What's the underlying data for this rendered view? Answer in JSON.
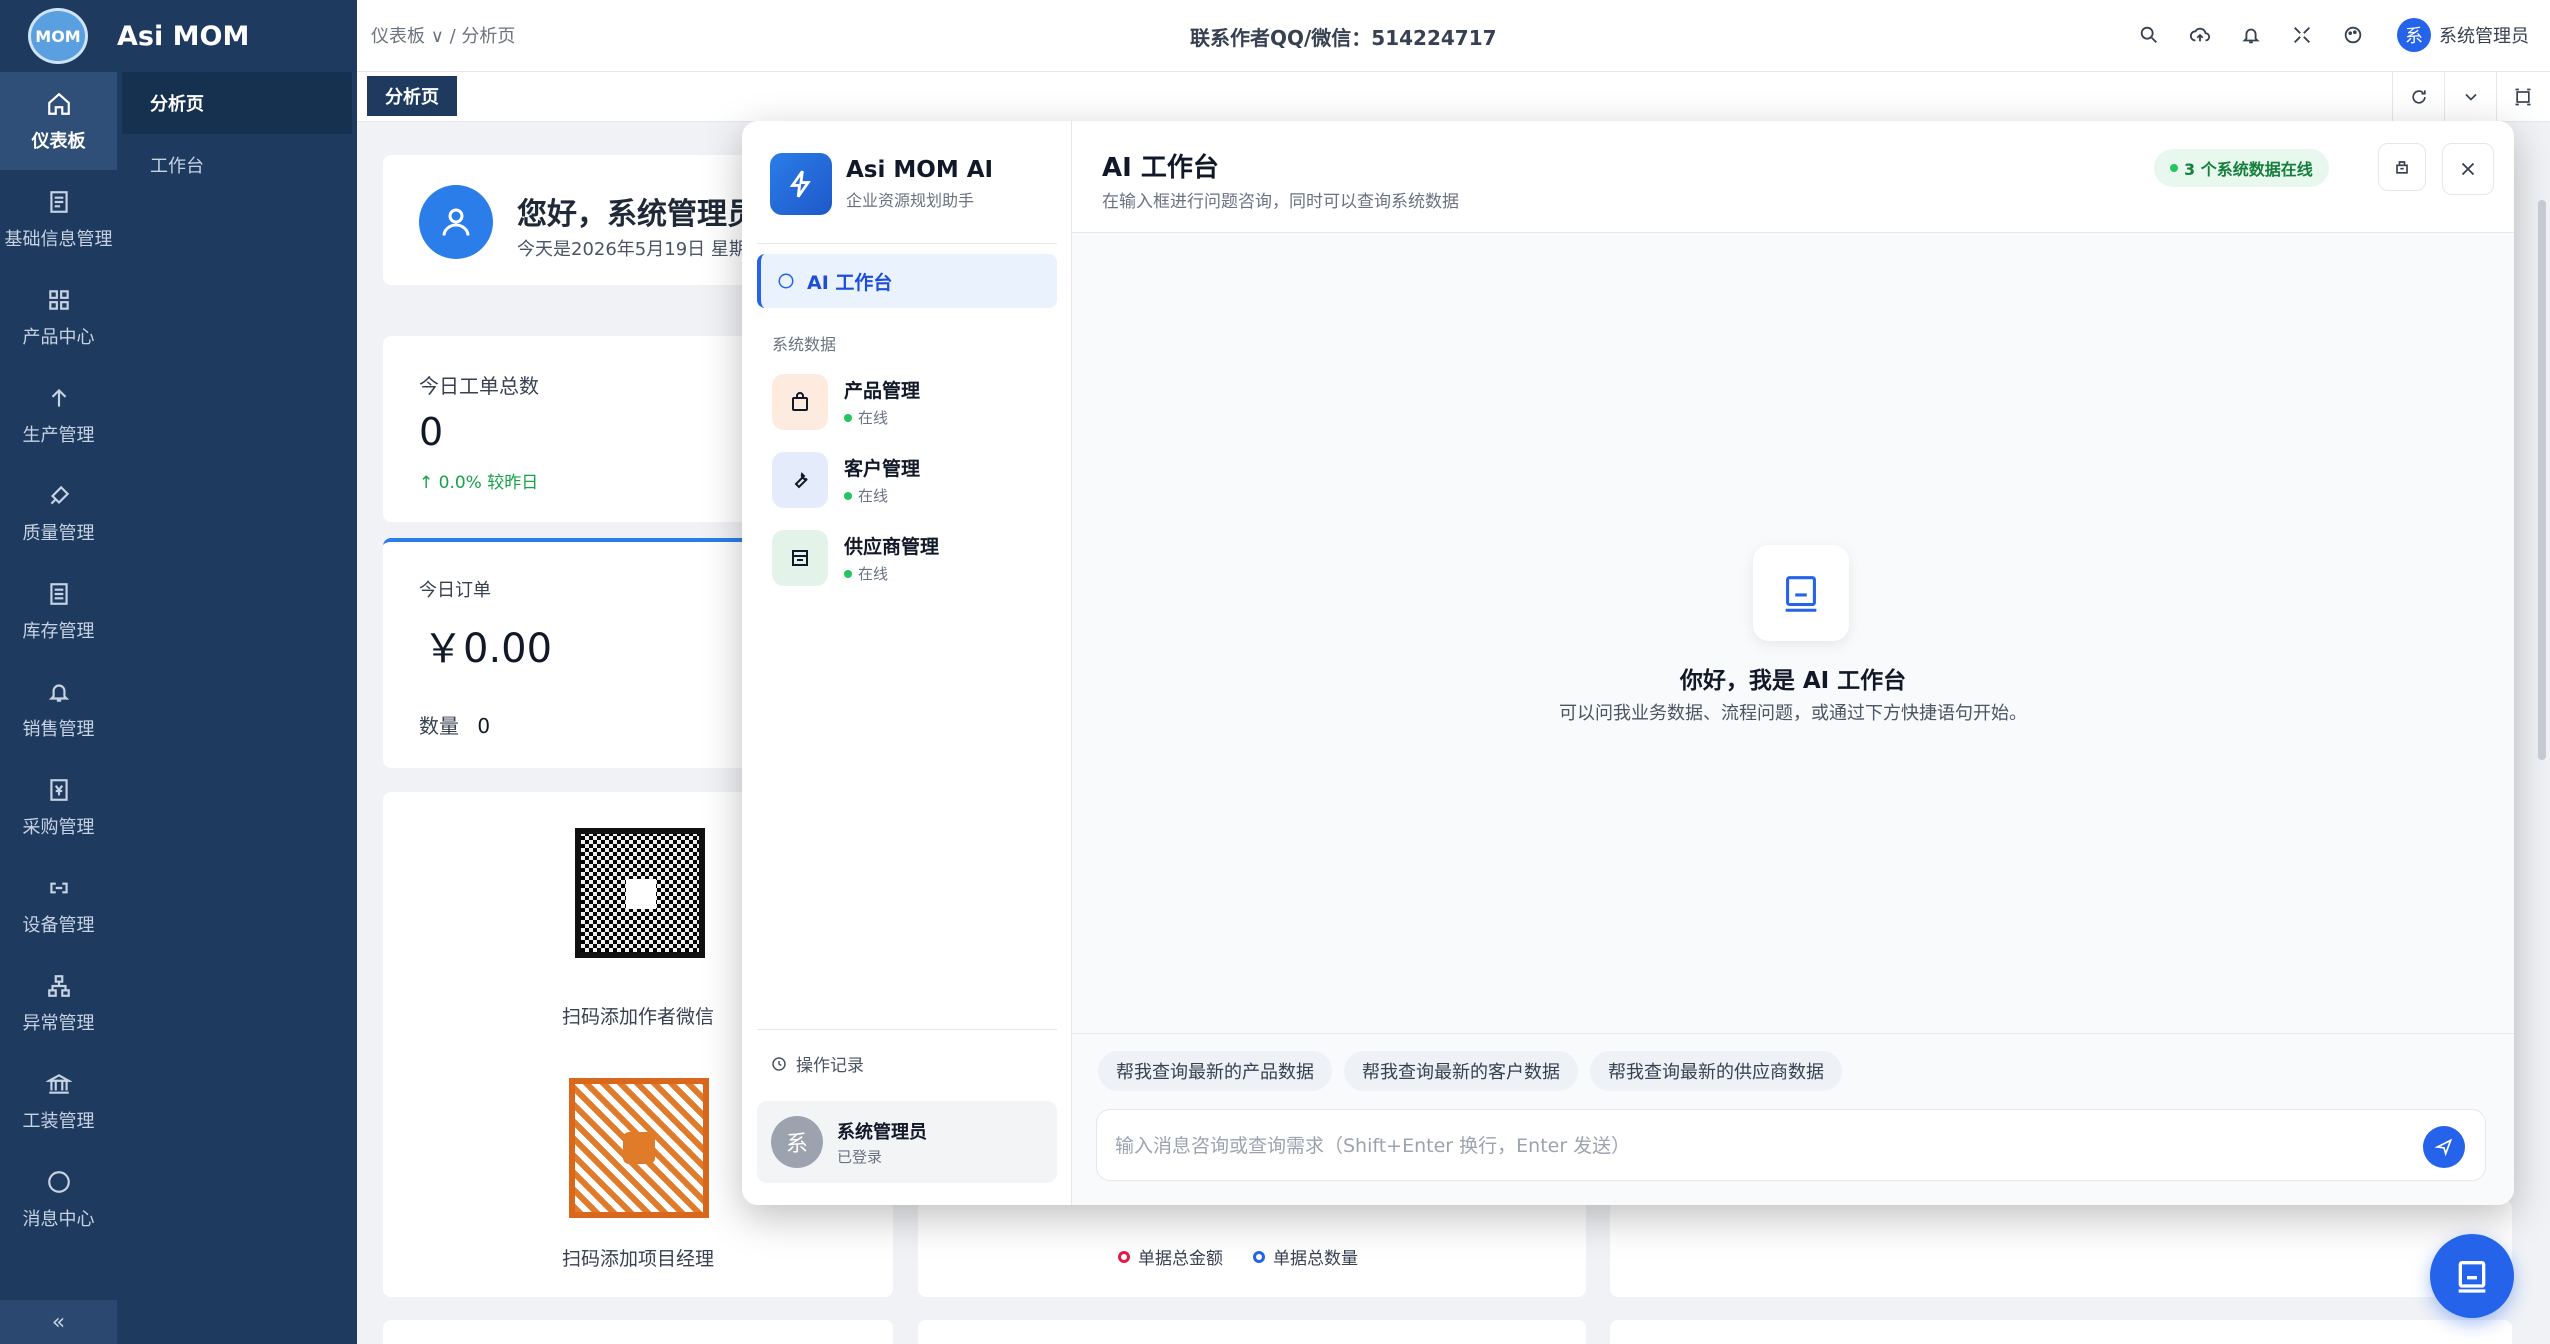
{
  "app": {
    "logo_text": "MOM",
    "brand": "Asi MOM"
  },
  "rail": {
    "items": [
      {
        "label": "仪表板",
        "icon": "home-icon"
      },
      {
        "label": "基础信息管理",
        "icon": "document-icon"
      },
      {
        "label": "产品中心",
        "icon": "grid-icon"
      },
      {
        "label": "生产管理",
        "icon": "arrow-up-icon"
      },
      {
        "label": "质量管理",
        "icon": "rocket-icon"
      },
      {
        "label": "库存管理",
        "icon": "list-icon"
      },
      {
        "label": "销售管理",
        "icon": "bell-icon"
      },
      {
        "label": "采购管理",
        "icon": "yen-icon"
      },
      {
        "label": "设备管理",
        "icon": "link-icon"
      },
      {
        "label": "异常管理",
        "icon": "tree-icon"
      },
      {
        "label": "工装管理",
        "icon": "bank-icon"
      },
      {
        "label": "消息中心",
        "icon": "chat-icon"
      }
    ],
    "collapse": "«"
  },
  "submenu": {
    "items": [
      "分析页",
      "工作台"
    ]
  },
  "topbar": {
    "breadcrumb": "仪表板 ∨ / 分析页",
    "contact": "联系作者QQ/微信：514224717",
    "user": "系统管理员",
    "user_initial": "系"
  },
  "tabs": {
    "active": "分析页"
  },
  "dashboard": {
    "greeting": "您好，系统管理员",
    "date_text": "今天是2026年5月19日 星期",
    "orders_total_label": "今日工单总数",
    "orders_total_value": "0",
    "orders_change": "↑ 0.0% 较昨日",
    "today_order_label": "今日订单",
    "today_order_amount": "￥0.00",
    "qty_label": "数量",
    "qty_value": "0",
    "qr1_caption": "扫码添加作者微信",
    "qr2_caption": "扫码添加项目经理",
    "legend": [
      "单据总金额",
      "单据总数量"
    ]
  },
  "assistant": {
    "name": "Asi MOM AI",
    "subtitle": "企业资源规划助手",
    "nav_workbench": "AI 工作台",
    "section_label": "系统数据",
    "systems": [
      {
        "name": "产品管理",
        "status": "在线"
      },
      {
        "name": "客户管理",
        "status": "在线"
      },
      {
        "name": "供应商管理",
        "status": "在线"
      }
    ],
    "history": "操作记录",
    "user_name": "系统管理员",
    "user_state": "已登录",
    "user_initial": "系",
    "title": "AI 工作台",
    "desc": "在输入框进行问题咨询，同时可以查询系统数据",
    "online_badge": "3 个系统数据在线",
    "welcome_title": "你好，我是 AI 工作台",
    "welcome_sub": "可以问我业务数据、流程问题，或通过下方快捷语句开始。",
    "quick": [
      "帮我查询最新的产品数据",
      "帮我查询最新的客户数据",
      "帮我查询最新的供应商数据"
    ],
    "input_placeholder": "输入消息咨询或查询需求（Shift+Enter 换行，Enter 发送）",
    "colors": {
      "accent": "#2563eb",
      "online": "#22c55e"
    }
  }
}
